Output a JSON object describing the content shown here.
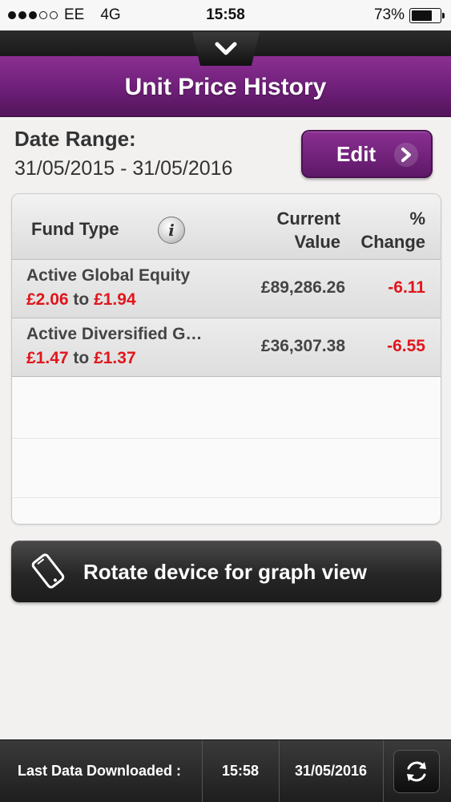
{
  "status_bar": {
    "carrier": "EE",
    "network": "4G",
    "time": "15:58",
    "battery_percent": "73%",
    "battery_level": 0.73,
    "signal_bars_filled": 3,
    "signal_bars_total": 5
  },
  "header": {
    "title": "Unit Price History",
    "collapse_icon": "chevron-down-icon"
  },
  "date_range": {
    "label": "Date Range:",
    "value": "31/05/2015 - 31/05/2016",
    "edit_label": "Edit",
    "edit_icon": "chevron-right-icon"
  },
  "table": {
    "columns": {
      "fund_type": "Fund Type",
      "current_value_line1": "Current",
      "current_value_line2": "Value",
      "change_line1": "%",
      "change_line2": "Change"
    },
    "info_icon_glyph": "i",
    "rows": [
      {
        "name": "Active Global Equity",
        "price_from": "£2.06",
        "price_to": "£1.94",
        "price_connector": "to",
        "current_value": "£89,286.26",
        "change": "-6.11"
      },
      {
        "name": "Active Diversified G…",
        "price_from": "£1.47",
        "price_to": "£1.37",
        "price_connector": "to",
        "current_value": "£36,307.38",
        "change": "-6.55"
      }
    ]
  },
  "rotate_banner": {
    "label": "Rotate device for graph view",
    "icon": "phone-rotate-icon"
  },
  "footer": {
    "last_downloaded_label": "Last Data Downloaded :",
    "time": "15:58",
    "date": "31/05/2016",
    "refresh_icon": "refresh-icon"
  },
  "colors": {
    "brand_purple": "#6e1f78",
    "negative_red": "#e0161c",
    "dark_bar": "#1e1e1e"
  }
}
